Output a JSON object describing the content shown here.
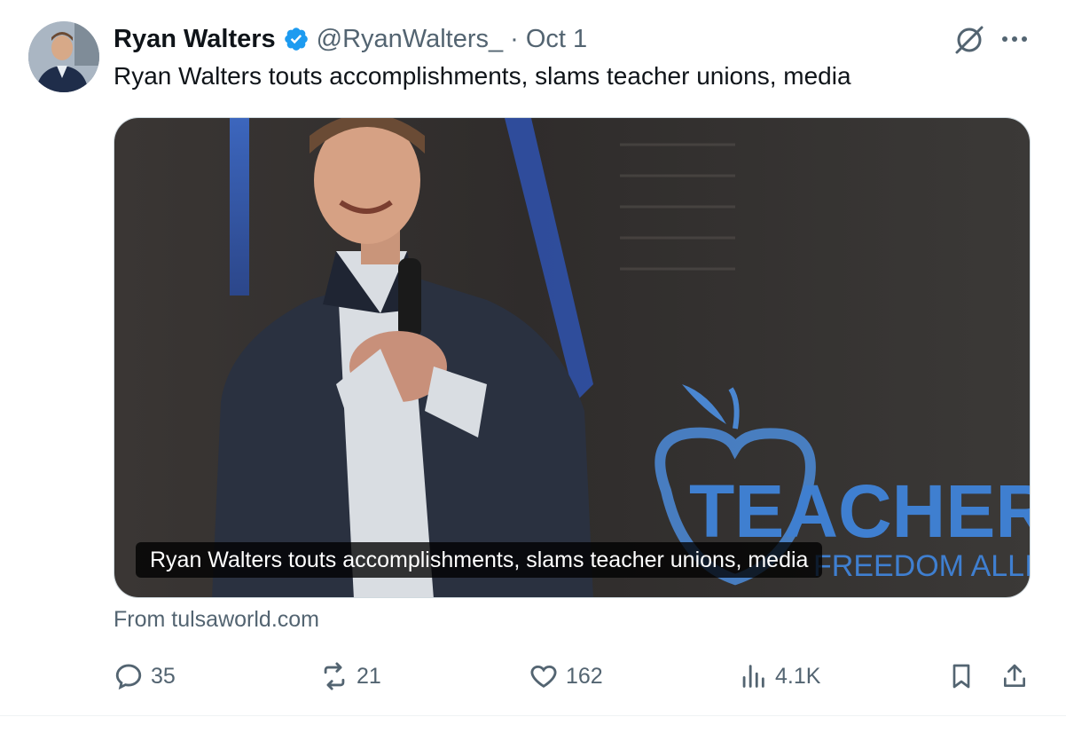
{
  "tweet": {
    "author_name": "Ryan Walters",
    "handle": "@RyanWalters_",
    "separator": "·",
    "date": "Oct 1",
    "text": "Ryan Walters touts accomplishments, slams teacher unions, media"
  },
  "card": {
    "caption": "Ryan Walters touts accomplishments, slams teacher unions, media",
    "source": "From tulsaworld.com",
    "backdrop_logo_text": "TEACHER",
    "backdrop_logo_subtext": "FREEDOM ALLIANCE"
  },
  "actions": {
    "replies": "35",
    "reposts": "21",
    "likes": "162",
    "views": "4.1K"
  },
  "icons": {
    "verified": "verified-badge-icon",
    "grok": "grok-icon",
    "more": "more-icon",
    "reply": "reply-icon",
    "repost": "repost-icon",
    "like": "heart-icon",
    "views": "views-icon",
    "bookmark": "bookmark-icon",
    "share": "share-icon"
  },
  "colors": {
    "verified_blue": "#1d9bf0",
    "text_primary": "#0f1419",
    "text_secondary": "#536471"
  }
}
